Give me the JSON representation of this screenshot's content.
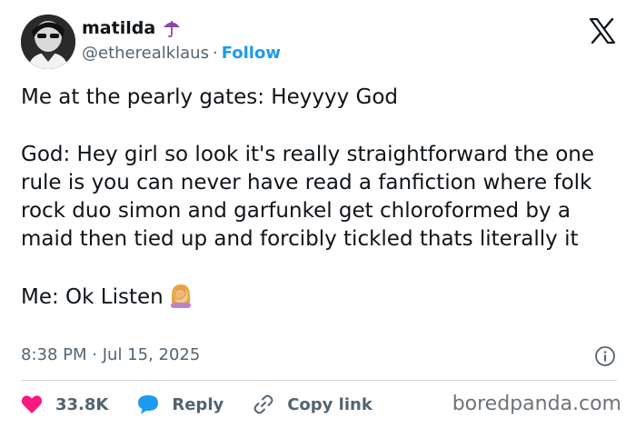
{
  "author": {
    "display_name": "matilda",
    "handle": "@etherealklaus",
    "separator": "·",
    "follow_label": "Follow",
    "name_badge_icon": "umbrella-icon"
  },
  "brand_icon": "x-logo-icon",
  "tweet": {
    "paragraphs": [
      "Me at the pearly gates: Heyyyy God",
      "God: Hey girl so look it's really straightforward the one rule is you can never have read a fanfiction where folk rock duo simon and garfunkel get chloroformed by a maid then tied up and forcibly tickled thats literally it",
      "Me: Ok Listen"
    ],
    "trailing_emoji": "facepalm-emoji",
    "time": "8:38 PM",
    "date": "Jul 15, 2025",
    "meta_separator": "·"
  },
  "actions": {
    "likes_count": "33.8K",
    "reply_label": "Reply",
    "copy_link_label": "Copy link"
  },
  "watermark": "boredpanda.com",
  "colors": {
    "text": "#0f1419",
    "muted": "#536471",
    "link": "#1d9bf0",
    "heart": "#f91880",
    "divider": "#cfd9de",
    "umbrella": "#8e44ad"
  }
}
